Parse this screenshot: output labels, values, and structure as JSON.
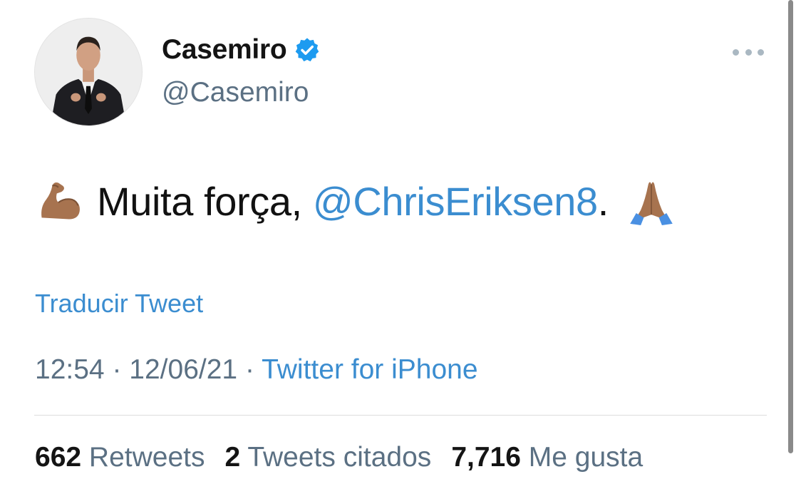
{
  "author": {
    "display_name": "Casemiro",
    "handle": "@Casemiro",
    "verified": true,
    "avatar_icon": "profile-photo"
  },
  "menu_icon": "more-options-icon",
  "tweet": {
    "emoji_start": "flexed-biceps-emoji",
    "text_before": "Muita força, ",
    "mention": "@ChrisEriksen8",
    "text_after": ".",
    "emoji_end": "folded-hands-emoji"
  },
  "translate_label": "Traducir Tweet",
  "meta": {
    "time": "12:54",
    "separator": "·",
    "date": "12/06/21",
    "source": "Twitter for iPhone"
  },
  "stats": {
    "retweets_count": "662",
    "retweets_label": "Retweets",
    "quotes_count": "2",
    "quotes_label": "Tweets citados",
    "likes_count": "7,716",
    "likes_label": "Me gusta"
  },
  "colors": {
    "link": "#3b8dd0",
    "muted": "#5b7083",
    "verified": "#1d9bf0"
  }
}
